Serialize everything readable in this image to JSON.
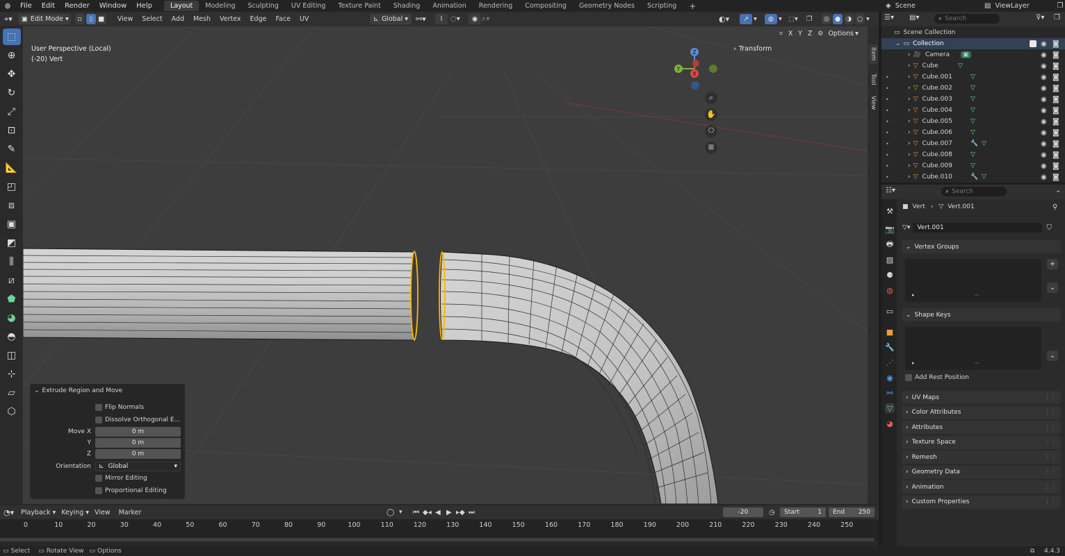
{
  "menu": [
    "File",
    "Edit",
    "Render",
    "Window",
    "Help"
  ],
  "workspaces": [
    "Layout",
    "Modeling",
    "Sculpting",
    "UV Editing",
    "Texture Paint",
    "Shading",
    "Animation",
    "Rendering",
    "Compositing",
    "Geometry Nodes",
    "Scripting"
  ],
  "active_workspace": "Layout",
  "scene_label": "Scene",
  "viewlayer_label": "ViewLayer",
  "header": {
    "mode": "Edit Mode",
    "menus": [
      "View",
      "Select",
      "Add",
      "Mesh",
      "Vertex",
      "Edge",
      "Face",
      "UV"
    ],
    "transform_orientation": "Global",
    "options_label": "Options",
    "axes": [
      "X",
      "Y",
      "Z"
    ]
  },
  "viewport": {
    "perspective_label": "User Perspective (Local)",
    "selection_label": "(-20) Vert",
    "transform_panel_label": "Transform",
    "gizmo_axes": [
      "X",
      "Y",
      "Z"
    ]
  },
  "npanel_tabs": [
    "Item",
    "Tool",
    "View"
  ],
  "operator_panel": {
    "title": "Extrude Region and Move",
    "flip_normals": "Flip Normals",
    "dissolve": "Dissolve Orthogonal E...",
    "move_label": "Move X",
    "y_label": "Y",
    "z_label": "Z",
    "move_x": "0 m",
    "move_y": "0 m",
    "move_z": "0 m",
    "orientation_label": "Orientation",
    "orientation_value": "Global",
    "mirror": "Mirror Editing",
    "proportional": "Proportional Editing"
  },
  "timeline": {
    "menus": [
      "Playback",
      "Keying",
      "View",
      "Marker"
    ],
    "current_frame": "-20",
    "start_label": "Start",
    "start_value": "1",
    "end_label": "End",
    "end_value": "250",
    "ruler": [
      "0",
      "10",
      "20",
      "30",
      "40",
      "50",
      "60",
      "70",
      "80",
      "90",
      "100",
      "110",
      "120",
      "130",
      "140",
      "150",
      "160",
      "170",
      "180",
      "190",
      "200",
      "210",
      "220",
      "230",
      "240",
      "250"
    ]
  },
  "status_bar": {
    "select": "Select",
    "rotate": "Rotate View",
    "options": "Options",
    "version": "4.4.3"
  },
  "outliner": {
    "search_placeholder": "Search",
    "scene_collection": "Scene Collection",
    "collection": "Collection",
    "items": [
      "Camera",
      "Cube",
      "Cube.001",
      "Cube.002",
      "Cube.003",
      "Cube.004",
      "Cube.005",
      "Cube.006",
      "Cube.007",
      "Cube.008",
      "Cube.009",
      "Cube.010"
    ]
  },
  "properties": {
    "search_placeholder": "Search",
    "breadcrumb_object": "Vert",
    "breadcrumb_data": "Vert.001",
    "data_name": "Vert.001",
    "vertex_groups": "Vertex Groups",
    "shape_keys": "Shape Keys",
    "add_rest_position": "Add Rest Position",
    "sections": [
      "UV Maps",
      "Color Attributes",
      "Attributes",
      "Texture Space",
      "Remesh",
      "Geometry Data",
      "Animation",
      "Custom Properties"
    ]
  },
  "colors": {
    "accent": "#4772b3",
    "selection": "#ffb800",
    "viewport_bg": "#3d3d3d"
  }
}
